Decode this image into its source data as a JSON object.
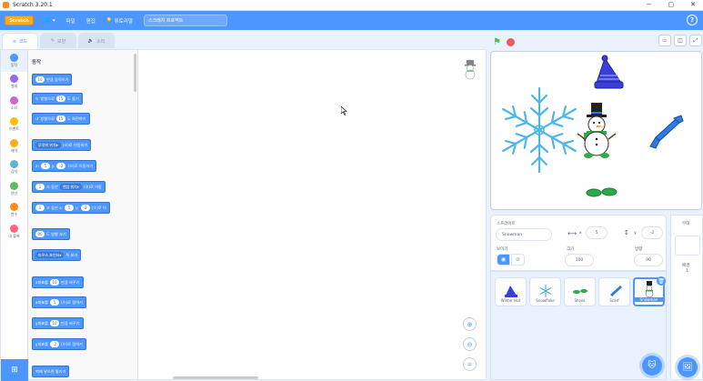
{
  "window": {
    "title": "Scratch 3.20.1",
    "min": "−",
    "max": "▢",
    "close": "✕"
  },
  "menu": {
    "logo": "Scratch",
    "file": "파일",
    "edit": "편집",
    "tutorials": "튜토리얼",
    "project_title": "스크래치 프로젝트",
    "help": "?"
  },
  "tabs": {
    "code": "코드",
    "costumes": "모양",
    "sounds": "소리"
  },
  "categories": [
    {
      "label": "동작",
      "color": "#4c97ff"
    },
    {
      "label": "형태",
      "color": "#9966ff"
    },
    {
      "label": "소리",
      "color": "#cf63cf"
    },
    {
      "label": "이벤트",
      "color": "#ffbf00"
    },
    {
      "label": "제어",
      "color": "#ffab19"
    },
    {
      "label": "감지",
      "color": "#5cb1d6"
    },
    {
      "label": "연산",
      "color": "#59c059"
    },
    {
      "label": "변수",
      "color": "#ff8c1a"
    },
    {
      "label": "내 블록",
      "color": "#ff6680"
    }
  ],
  "palette": {
    "title": "동작",
    "blocks": {
      "move": {
        "pre": "",
        "val": "10",
        "post": "만큼 움직이기"
      },
      "turn_right": {
        "pre": "방향으로",
        "val": "15",
        "post": "도 돌기"
      },
      "turn_left": {
        "pre": "방향으로",
        "val": "15",
        "post": "도 회전하기"
      },
      "goto": {
        "pre": "",
        "dd": "무작위 위치",
        "post": "(으)로 이동하기"
      },
      "gotoxy": {
        "a": "x:",
        "x": "5",
        "b": "y:",
        "y": "-2",
        "post": "(으)로 이동하기"
      },
      "glide_to": {
        "val": "1",
        "a": "초 동안",
        "dd": "랜덤 위치",
        "post": "(으)로 이동"
      },
      "glide_xy": {
        "val": "1",
        "a": "초 동안 x:",
        "x": "5",
        "b": "y:",
        "y": "-2",
        "post": "(으)로 이"
      },
      "point_dir": {
        "val": "90",
        "post": "도 방향 보기"
      },
      "point_towards": {
        "dd": "마우스 포인터",
        "post": "쪽 보기"
      },
      "change_x": {
        "pre": "x좌표를",
        "val": "10",
        "post": "만큼 바꾸기"
      },
      "set_x": {
        "pre": "x좌표를",
        "val": "5",
        "post": "(으)로 정하기"
      },
      "change_y": {
        "pre": "y좌표를",
        "val": "10",
        "post": "만큼 바꾸기"
      },
      "set_y": {
        "pre": "y좌표를",
        "val": "-2",
        "post": "(으)로 정하기"
      },
      "bounce": {
        "text": "벽에 닿으면 튕기기"
      }
    }
  },
  "sprite_info": {
    "sprite_label": "스프라이트",
    "sprite_name": "Snowman",
    "x_label": "x",
    "x": "5",
    "y_label": "y",
    "y": "-2",
    "show_label": "보이기",
    "size_label": "크기",
    "size": "100",
    "dir_label": "방향",
    "direction": "90"
  },
  "sprites": [
    {
      "name": "Winter Hat",
      "selected": false
    },
    {
      "name": "Snowflake",
      "selected": false
    },
    {
      "name": "Shoes",
      "selected": false
    },
    {
      "name": "Scarf",
      "selected": false
    },
    {
      "name": "Snowman",
      "selected": true
    }
  ],
  "stage_panel": {
    "title": "무대",
    "backdrops_label": "배경",
    "backdrops_count": "1"
  }
}
